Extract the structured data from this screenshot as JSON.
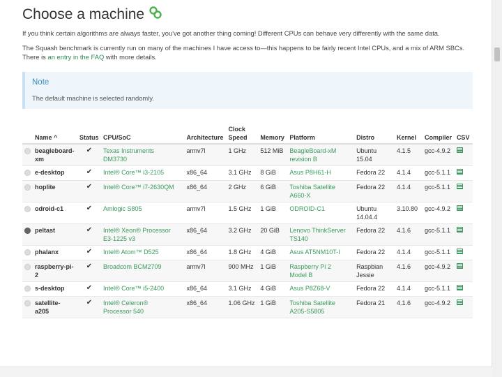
{
  "page": {
    "title": "Choose a machine",
    "intro": "If you think certain algorithms are always faster, you've got another thing coming! Different CPUs can behave very differently with the same data.",
    "bench_line1": "The Squash benchmark is currently run on many of the machines I have access to—this happens to be fairly recent Intel CPUs, and a mix of ARM SBCs.",
    "bench_line2_pre": "There is ",
    "bench_link": "an entry in the FAQ",
    "bench_line2_post": " with more details."
  },
  "note": {
    "title": "Note",
    "body": "The default machine is selected randomly."
  },
  "table": {
    "headers": {
      "name": "Name ^",
      "status": "Status",
      "cpu": "CPU/SoC",
      "arch": "Architecture",
      "clock1": "Clock",
      "clock2": "Speed",
      "memory": "Memory",
      "platform": "Platform",
      "distro": "Distro",
      "kernel": "Kernel",
      "compiler": "Compiler",
      "csv": "CSV"
    },
    "rows": [
      {
        "name1": "beagleboard-",
        "name2": "xm",
        "status": "✔",
        "cpu1": "Texas Instruments",
        "cpu2": "DM3730",
        "arch": "armv7l",
        "clock": "1 GHz",
        "memory": "512 MiB",
        "plat1": "BeagleBoard-xM",
        "plat2": "revision B",
        "dist1": "Ubuntu",
        "dist2": "15.04",
        "kernel": "4.1.5",
        "compiler": "gcc-4.9.2",
        "selected": false
      },
      {
        "name1": "e-desktop",
        "name2": "",
        "status": "✔",
        "cpu1": "Intel® Core™ i3-2105",
        "cpu2": "",
        "arch": "x86_64",
        "clock": "3.1 GHz",
        "memory": "8 GiB",
        "plat1": "Asus P8H61-H",
        "plat2": "",
        "dist1": "Fedora 22",
        "dist2": "",
        "kernel": "4.1.4",
        "compiler": "gcc-5.1.1",
        "selected": false
      },
      {
        "name1": "hoplite",
        "name2": "",
        "status": "✔",
        "cpu1": "Intel® Core™ i7-2630QM",
        "cpu2": "",
        "arch": "x86_64",
        "clock": "2 GHz",
        "memory": "6 GiB",
        "plat1": "Toshiba Satellite",
        "plat2": "A660-X",
        "dist1": "Fedora 22",
        "dist2": "",
        "kernel": "4.1.4",
        "compiler": "gcc-5.1.1",
        "selected": false
      },
      {
        "name1": "odroid-c1",
        "name2": "",
        "status": "✔",
        "cpu1": "Amlogic S805",
        "cpu2": "",
        "arch": "armv7l",
        "clock": "1.5 GHz",
        "memory": "1 GiB",
        "plat1": "ODROID-C1",
        "plat2": "",
        "dist1": "Ubuntu",
        "dist2": "14.04.4",
        "kernel": "3.10.80",
        "compiler": "gcc-4.9.2",
        "selected": false
      },
      {
        "name1": "peltast",
        "name2": "",
        "status": "✔",
        "cpu1": "Intel® Xeon® Processor",
        "cpu2": "E3-1225 v3",
        "arch": "x86_64",
        "clock": "3.2 GHz",
        "memory": "20 GiB",
        "plat1": "Lenovo ThinkServer",
        "plat2": "TS140",
        "dist1": "Fedora 22",
        "dist2": "",
        "kernel": "4.1.6",
        "compiler": "gcc-5.1.1",
        "selected": true
      },
      {
        "name1": "phalanx",
        "name2": "",
        "status": "✔",
        "cpu1": "Intel® Atom™ D525",
        "cpu2": "",
        "arch": "x86_64",
        "clock": "1.8 GHz",
        "memory": "4 GiB",
        "plat1": "Asus AT5NM10T-I",
        "plat2": "",
        "dist1": "Fedora 22",
        "dist2": "",
        "kernel": "4.1.4",
        "compiler": "gcc-5.1.1",
        "selected": false
      },
      {
        "name1": "raspberry-pi-",
        "name2": "2",
        "status": "✔",
        "cpu1": "Broadcom BCM2709",
        "cpu2": "",
        "arch": "armv7l",
        "clock": "900 MHz",
        "memory": "1 GiB",
        "plat1": "Raspberry Pi 2",
        "plat2": "Model B",
        "dist1": "Raspbian",
        "dist2": "Jessie",
        "kernel": "4.1.6",
        "compiler": "gcc-4.9.2",
        "selected": false
      },
      {
        "name1": "s-desktop",
        "name2": "",
        "status": "✔",
        "cpu1": "Intel® Core™ i5-2400",
        "cpu2": "",
        "arch": "x86_64",
        "clock": "3.1 GHz",
        "memory": "4 GiB",
        "plat1": "Asus P8Z68-V",
        "plat2": "",
        "dist1": "Fedora 22",
        "dist2": "",
        "kernel": "4.1.4",
        "compiler": "gcc-5.1.1",
        "selected": false
      },
      {
        "name1": "satellite-",
        "name2": "a205",
        "status": "✔",
        "cpu1": "Intel® Celeron®",
        "cpu2": "Processor 540",
        "arch": "x86_64",
        "clock": "1.06 GHz",
        "memory": "1 GiB",
        "plat1": "Toshiba Satellite",
        "plat2": "A205-S5805",
        "dist1": "Fedora 21",
        "dist2": "",
        "kernel": "4.1.6",
        "compiler": "gcc-4.9.2",
        "selected": false
      }
    ]
  }
}
